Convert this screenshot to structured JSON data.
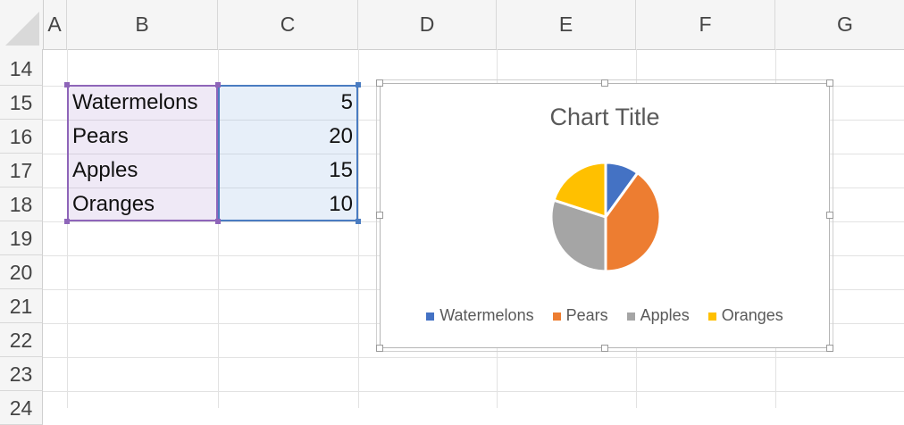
{
  "columns": [
    "A",
    "B",
    "C",
    "D",
    "E",
    "F",
    "G"
  ],
  "rows": [
    "14",
    "15",
    "16",
    "17",
    "18",
    "19",
    "20",
    "21",
    "22",
    "23",
    "24"
  ],
  "table": [
    {
      "label": "Watermelons",
      "value": "5"
    },
    {
      "label": "Pears",
      "value": "20"
    },
    {
      "label": "Apples",
      "value": "15"
    },
    {
      "label": "Oranges",
      "value": "10"
    }
  ],
  "colors": {
    "watermelons": "#4472c4",
    "pears": "#ed7d31",
    "apples": "#a5a5a5",
    "oranges": "#ffc000",
    "selection_b": "#8e65b9",
    "selection_c": "#4a7cc1"
  },
  "chart_data": {
    "type": "pie",
    "title": "Chart Title",
    "categories": [
      "Watermelons",
      "Pears",
      "Apples",
      "Oranges"
    ],
    "values": [
      5,
      20,
      15,
      10
    ],
    "legend_position": "bottom"
  }
}
